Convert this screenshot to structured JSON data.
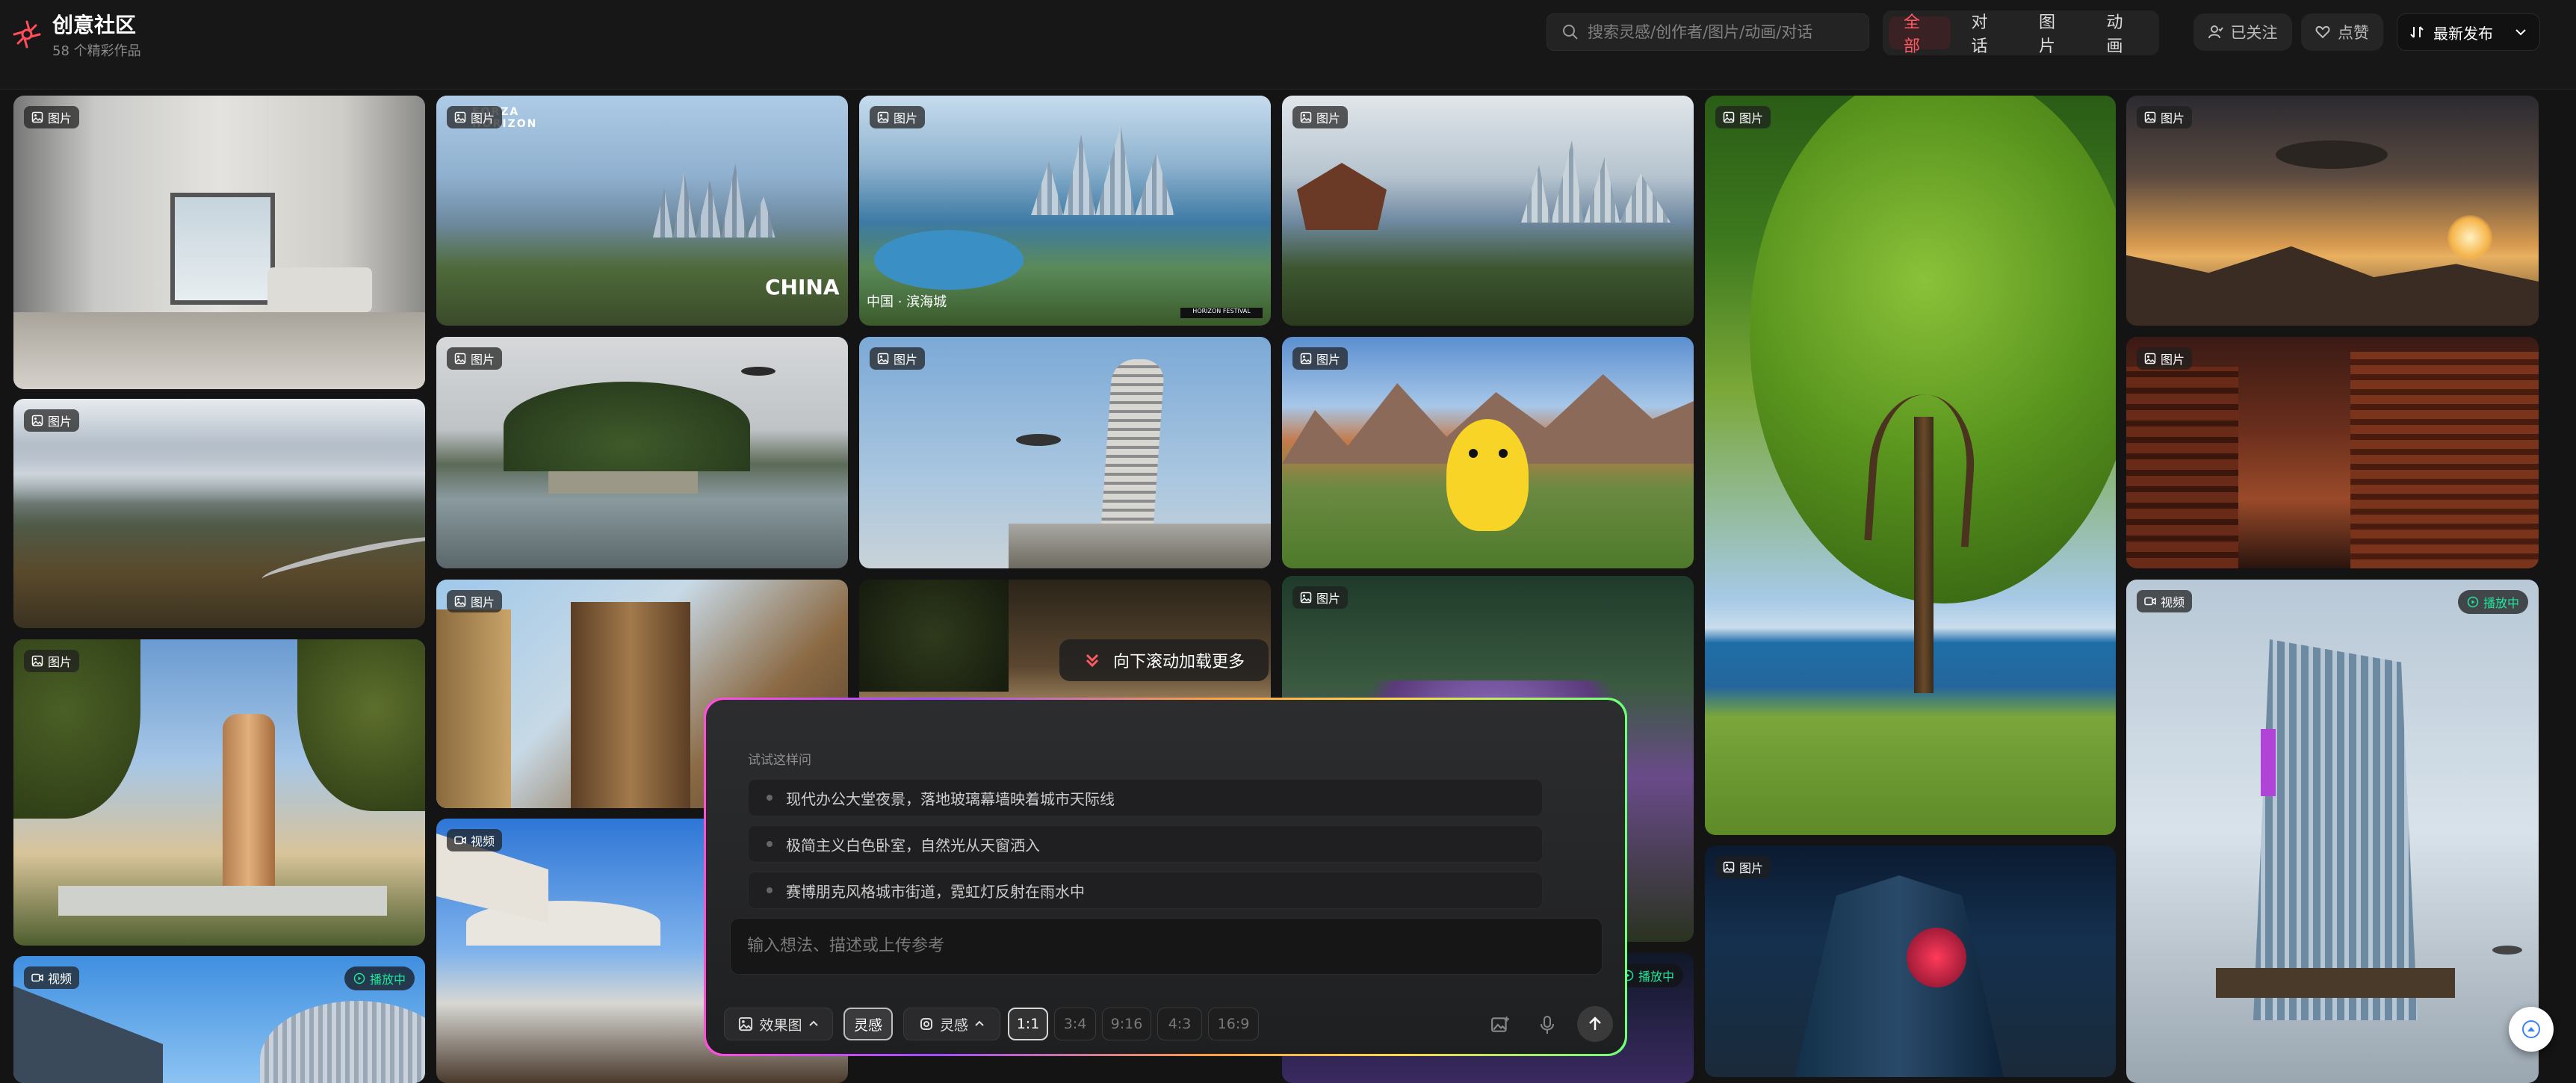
{
  "header": {
    "title": "创意社区",
    "subtitle": "58 个精彩作品",
    "search_placeholder": "搜索灵感/创作者/图片/动画/对话",
    "tabs": [
      "全部",
      "对话",
      "图片",
      "动画"
    ],
    "active_tab": "全部",
    "follow_label": "已关注",
    "like_label": "点赞",
    "sort_label": "最新发布",
    "accent_color": "#ff5b62"
  },
  "badges": {
    "image": "图片",
    "video": "视频",
    "playing": "播放中"
  },
  "card_texts": {
    "forza_logo": "FORZA HORIZON",
    "china": "CHINA",
    "china_sub": "中国 · 滨海城",
    "horizon_festival": "HORIZON FESTIVAL"
  },
  "load_more": "向下滚动加载更多",
  "composer": {
    "try_label": "试试这样问",
    "suggestions": [
      "现代办公大堂夜景，落地玻璃幕墙映着城市天际线",
      "极简主义白色卧室，自然光从天窗洒入",
      "赛博朋克风格城市街道，霓虹灯反射在雨水中"
    ],
    "input_placeholder": "输入想法、描述或上传参考",
    "mode_label": "效果图",
    "inspire_label": "灵感",
    "model_label": "灵感",
    "ratios": [
      "1:1",
      "3:4",
      "9:16",
      "4:3",
      "16:9"
    ],
    "selected_ratio": "1:1"
  }
}
